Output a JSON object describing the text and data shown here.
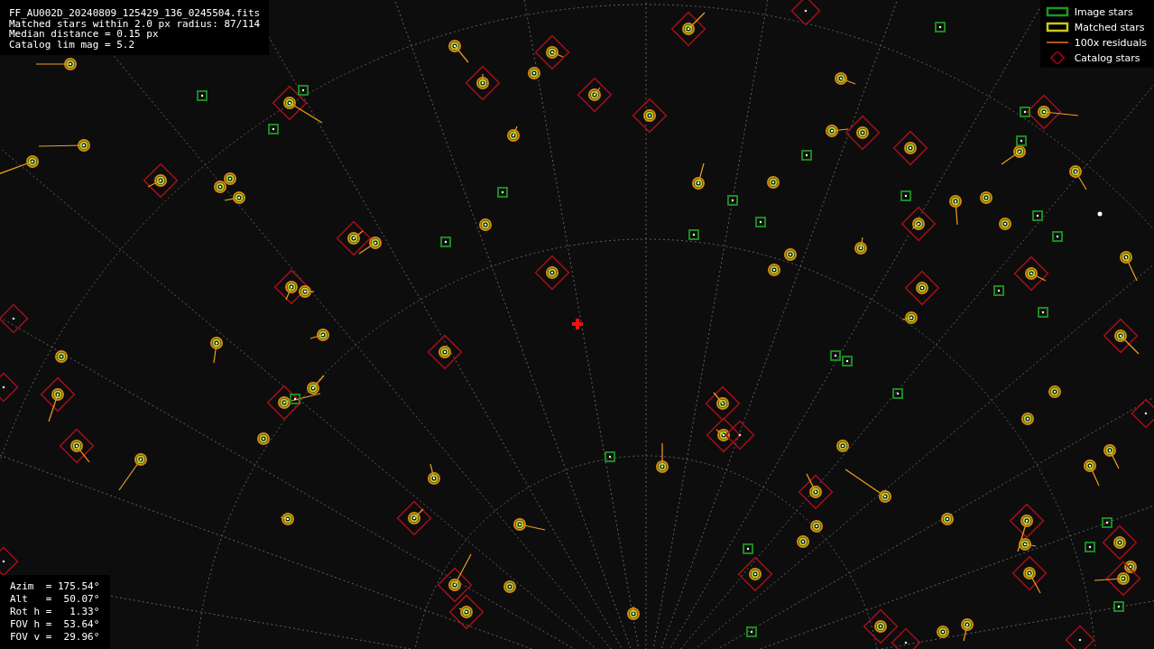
{
  "header_lines": [
    "FF_AU002D_20240809_125429_136_0245504.fits",
    "Matched stars within 2.0 px radius: 87/114",
    "Median distance = 0.15 px",
    "Catalog lim mag = 5.2"
  ],
  "legend": [
    {
      "kind": "image",
      "label": "Image stars"
    },
    {
      "kind": "matched",
      "label": "Matched stars"
    },
    {
      "kind": "residual",
      "label": "100x residuals"
    },
    {
      "kind": "catalog",
      "label": "Catalog stars"
    }
  ],
  "pointing_lines": [
    "Azim  = 175.54°",
    "Alt   =  50.07°",
    "Rot h =   1.33°",
    "FOV h =  53.64°",
    "FOV v =  29.96°"
  ]
}
